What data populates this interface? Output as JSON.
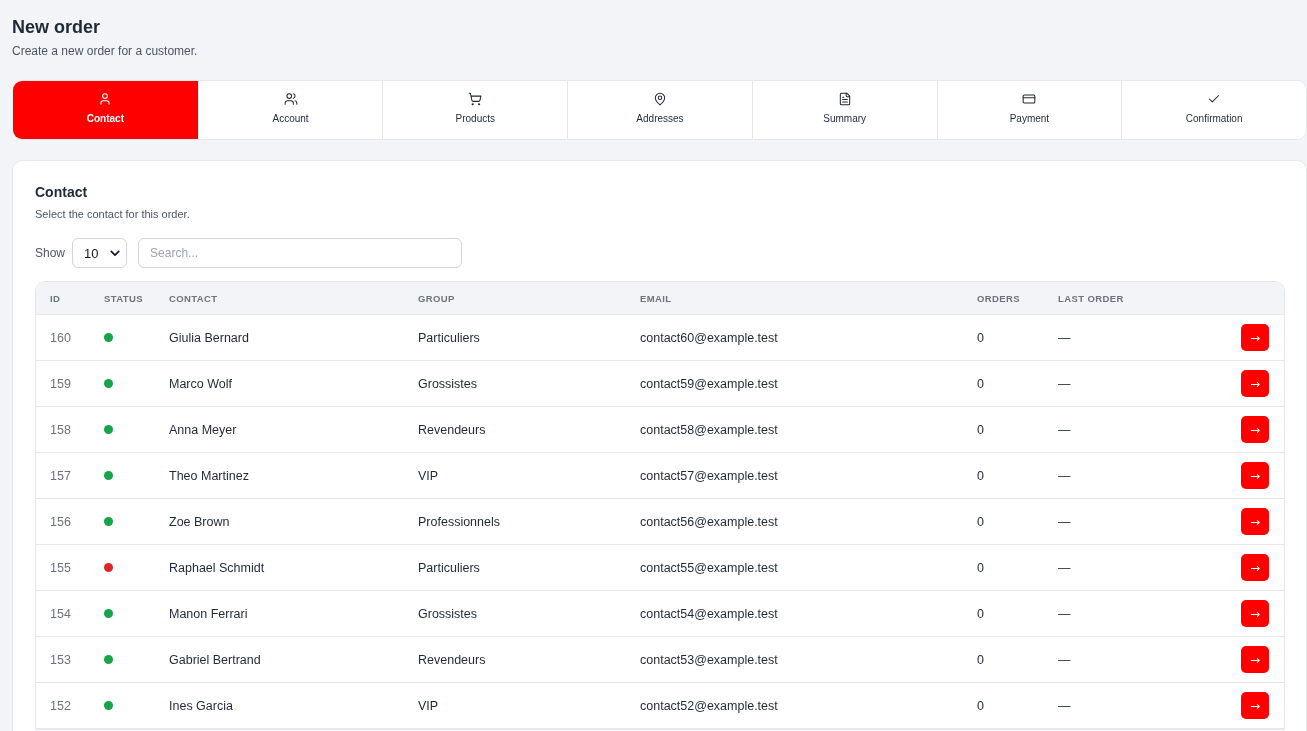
{
  "header": {
    "title": "New order",
    "subtitle": "Create a new order for a customer."
  },
  "steps": [
    {
      "label": "Contact",
      "selected": true
    },
    {
      "label": "Account",
      "selected": false
    },
    {
      "label": "Products",
      "selected": false
    },
    {
      "label": "Addresses",
      "selected": false
    },
    {
      "label": "Summary",
      "selected": false
    },
    {
      "label": "Payment",
      "selected": false
    },
    {
      "label": "Confirmation",
      "selected": false
    }
  ],
  "panel": {
    "title": "Contact",
    "subtitle": "Select the contact for this order.",
    "show_label": "Show",
    "page_size": "10",
    "search": {
      "placeholder": "Search..."
    }
  },
  "table": {
    "columns": [
      "ID",
      "STATUS",
      "CONTACT",
      "GROUP",
      "EMAIL",
      "ORDERS",
      "LAST ORDER"
    ],
    "rows": [
      {
        "id": "160",
        "color": "#16a34a",
        "contact": "Giulia Bernard",
        "group": "Particuliers",
        "email": "contact60@example.test",
        "orders": "0",
        "last_order": "—",
        "action": "→"
      },
      {
        "id": "159",
        "color": "#16a34a",
        "contact": "Marco Wolf",
        "group": "Grossistes",
        "email": "contact59@example.test",
        "orders": "0",
        "last_order": "—",
        "action": "→"
      },
      {
        "id": "158",
        "color": "#16a34a",
        "contact": "Anna Meyer",
        "group": "Revendeurs",
        "email": "contact58@example.test",
        "orders": "0",
        "last_order": "—",
        "action": "→"
      },
      {
        "id": "157",
        "color": "#16a34a",
        "contact": "Theo Martinez",
        "group": "VIP",
        "email": "contact57@example.test",
        "orders": "0",
        "last_order": "—",
        "action": "→"
      },
      {
        "id": "156",
        "color": "#16a34a",
        "contact": "Zoe Brown",
        "group": "Professionnels",
        "email": "contact56@example.test",
        "orders": "0",
        "last_order": "—",
        "action": "→"
      },
      {
        "id": "155",
        "color": "#dc2626",
        "contact": "Raphael Schmidt",
        "group": "Particuliers",
        "email": "contact55@example.test",
        "orders": "0",
        "last_order": "—",
        "action": "→"
      },
      {
        "id": "154",
        "color": "#16a34a",
        "contact": "Manon Ferrari",
        "group": "Grossistes",
        "email": "contact54@example.test",
        "orders": "0",
        "last_order": "—",
        "action": "→"
      },
      {
        "id": "153",
        "color": "#16a34a",
        "contact": "Gabriel Bertrand",
        "group": "Revendeurs",
        "email": "contact53@example.test",
        "orders": "0",
        "last_order": "—",
        "action": "→"
      },
      {
        "id": "152",
        "color": "#16a34a",
        "contact": "Ines Garcia",
        "group": "VIP",
        "email": "contact52@example.test",
        "orders": "0",
        "last_order": "—",
        "action": "→"
      }
    ]
  }
}
